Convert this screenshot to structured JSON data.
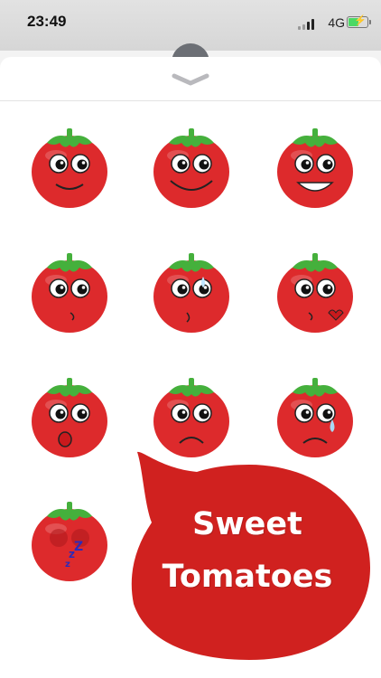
{
  "status_bar": {
    "time": "23:49",
    "network": "4G",
    "battery_level": 0.6
  },
  "promo": {
    "line1": "Sweet",
    "line2": "Tomatoes"
  },
  "stickers": [
    {
      "name": "tomato-smile"
    },
    {
      "name": "tomato-grin"
    },
    {
      "name": "tomato-laugh"
    },
    {
      "name": "tomato-smirk"
    },
    {
      "name": "tomato-sweat"
    },
    {
      "name": "tomato-kiss"
    },
    {
      "name": "tomato-surprised"
    },
    {
      "name": "tomato-sad"
    },
    {
      "name": "tomato-crying"
    },
    {
      "name": "tomato-sleeping"
    }
  ],
  "colors": {
    "tomato_red": "#dd2a2c",
    "leaf_green": "#45b03c",
    "bubble_red": "#d0211f"
  }
}
